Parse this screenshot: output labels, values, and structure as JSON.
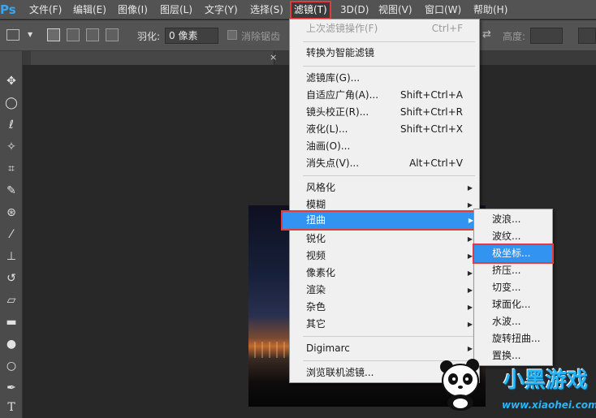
{
  "app": {
    "logo": "Ps"
  },
  "menubar": {
    "items": [
      "文件(F)",
      "编辑(E)",
      "图像(I)",
      "图层(L)",
      "文字(Y)",
      "选择(S)",
      "滤镜(T)",
      "3D(D)",
      "视图(V)",
      "窗口(W)",
      "帮助(H)"
    ],
    "active_index": 6
  },
  "options": {
    "feather_label": "羽化:",
    "feather_value": "0 像素",
    "antialias_label": "消除锯齿",
    "height_label": "高度:"
  },
  "tab": {
    "close": "×"
  },
  "filter_menu": {
    "last_filter": {
      "label": "上次滤镜操作(F)",
      "shortcut": "Ctrl+F"
    },
    "smart": {
      "label": "转换为智能滤镜"
    },
    "group1": [
      {
        "label": "滤镜库(G)...",
        "shortcut": ""
      },
      {
        "label": "自适应广角(A)...",
        "shortcut": "Shift+Ctrl+A"
      },
      {
        "label": "镜头校正(R)...",
        "shortcut": "Shift+Ctrl+R"
      },
      {
        "label": "液化(L)...",
        "shortcut": "Shift+Ctrl+X"
      },
      {
        "label": "油画(O)...",
        "shortcut": ""
      },
      {
        "label": "消失点(V)...",
        "shortcut": "Alt+Ctrl+V"
      }
    ],
    "group2": [
      "风格化",
      "模糊",
      "扭曲",
      "锐化",
      "视频",
      "像素化",
      "渲染",
      "杂色",
      "其它"
    ],
    "highlight_item": "扭曲",
    "digimarc": "Digimarc",
    "browse": "浏览联机滤镜..."
  },
  "distort_submenu": {
    "items": [
      "波浪...",
      "波纹...",
      "极坐标...",
      "挤压...",
      "切变...",
      "球面化...",
      "水波...",
      "旋转扭曲...",
      "置换..."
    ],
    "highlight_item": "极坐标..."
  },
  "watermark": {
    "title": "小黑游戏",
    "url": "www.xiaohei.com"
  },
  "colors": {
    "highlight": "#3294f0",
    "callout": "#e23b3b",
    "menu_bg": "#f0f0f0",
    "ui_dark": "#535353"
  },
  "icons": [
    "move-icon",
    "marquee-icon",
    "lasso-icon",
    "magic-wand-icon",
    "crop-icon",
    "eyedropper-icon",
    "healing-brush-icon",
    "brush-icon",
    "clone-stamp-icon",
    "history-brush-icon",
    "eraser-icon",
    "gradient-icon",
    "blur-icon",
    "dodge-icon",
    "pen-icon",
    "type-icon"
  ]
}
